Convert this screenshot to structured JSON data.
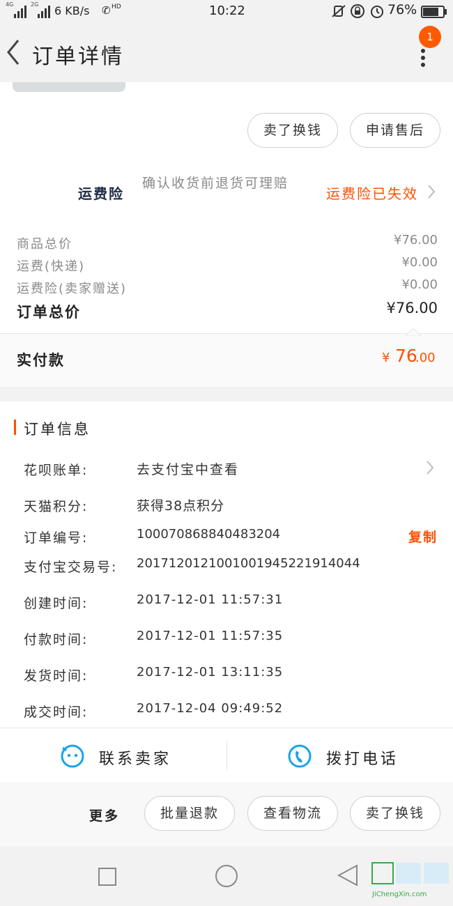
{
  "status_bar": {
    "network_left": "4G",
    "network_right": "2G",
    "speed": "6 KB/s",
    "hd": "HD",
    "time": "10:22",
    "battery": "76%"
  },
  "header": {
    "title": "订单详情",
    "badge_count": "1"
  },
  "actions_top": {
    "sell_label": "卖了换钱",
    "after_sale_label": "申请售后"
  },
  "insurance": {
    "title": "运费险",
    "description": "确认收货前退货可理赔",
    "status": "运费险已失效"
  },
  "price_summary": {
    "items": [
      {
        "label": "商品总价",
        "value": "¥76.00"
      },
      {
        "label": "运费(快递)",
        "value": "¥0.00"
      },
      {
        "label": "运费险(卖家赠送)",
        "value": "¥0.00"
      }
    ],
    "total_label": "订单总价",
    "total_value": "¥76.00",
    "paid_label": "实付款",
    "paid_currency": "¥",
    "paid_int": "76",
    "paid_dec": ".00"
  },
  "order_info": {
    "section_title": "订单信息",
    "huabei_label": "花呗账单:",
    "huabei_value": "去支付宝中查看",
    "points_label": "天猫积分:",
    "points_value": "获得38点积分",
    "order_no_label": "订单编号:",
    "order_no_value": "100070868840483204",
    "copy_label": "复制",
    "alipay_label": "支付宝交易号:",
    "alipay_value": "2017120121001001945221914044",
    "created_label": "创建时间:",
    "created_value": "2017-12-01 11:57:31",
    "paid_label": "付款时间:",
    "paid_value": "2017-12-01 11:57:35",
    "shipped_label": "发货时间:",
    "shipped_value": "2017-12-01 13:11:35",
    "completed_label": "成交时间:",
    "completed_value": "2017-12-04 09:49:52"
  },
  "contact": {
    "seller_label": "联系卖家",
    "phone_label": "拨打电话"
  },
  "bottom_bar": {
    "more_label": "更多",
    "batch_refund_label": "批量退款",
    "logistics_label": "查看物流",
    "sell_label": "卖了换钱"
  },
  "watermark": {
    "text": "JiChengXin.com"
  },
  "colors": {
    "accent": "#ff5000",
    "blue_icon": "#1aa3e8",
    "background": "#f2f2f2"
  }
}
